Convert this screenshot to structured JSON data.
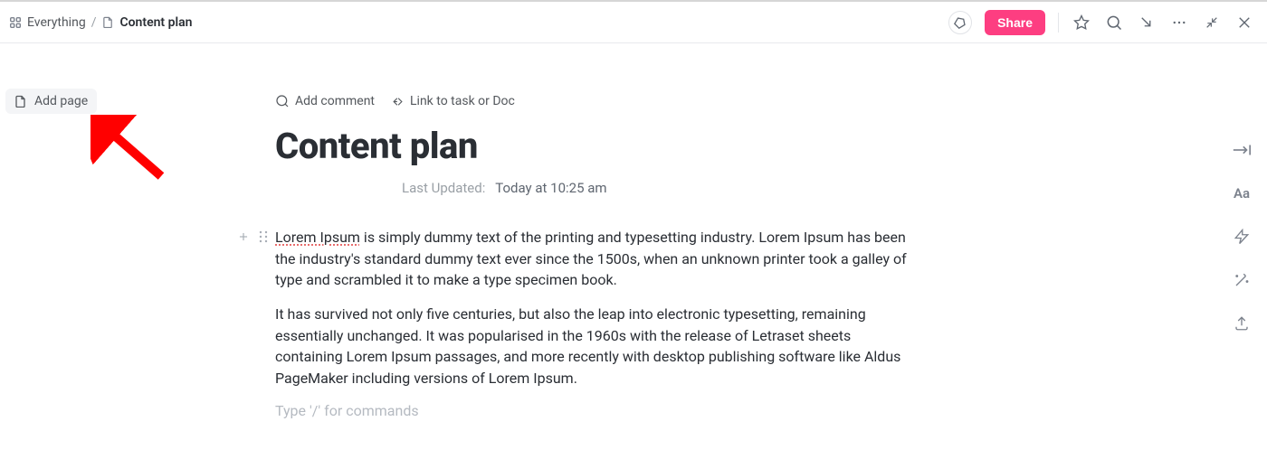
{
  "breadcrumb": {
    "root": "Everything",
    "current": "Content plan"
  },
  "topbar": {
    "share_label": "Share"
  },
  "sidebar": {
    "add_page_label": "Add page"
  },
  "doc": {
    "actions": {
      "add_comment": "Add comment",
      "link_to_task": "Link to task or Doc"
    },
    "title": "Content plan",
    "last_updated": {
      "label": "Last Updated:",
      "value": "Today at 10:25 am"
    },
    "paragraphs": [
      "Lorem Ipsum is simply dummy text of the printing and typesetting industry. Lorem Ipsum has been the industry's standard dummy text ever since the 1500s, when an unknown printer took a galley of type and scrambled it to make a type specimen book.",
      "It has survived not only five centuries, but also the leap into electronic typesetting, remaining essentially unchanged. It was popularised in the 1960s with the release of Letraset sheets containing Lorem Ipsum passages, and more recently with desktop publishing software like Aldus PageMaker including versions of Lorem Ipsum."
    ],
    "spell_word": "Lorem Ipsum",
    "command_placeholder": "Type '/' for commands"
  },
  "right_rail": {
    "font_label": "Aa"
  }
}
